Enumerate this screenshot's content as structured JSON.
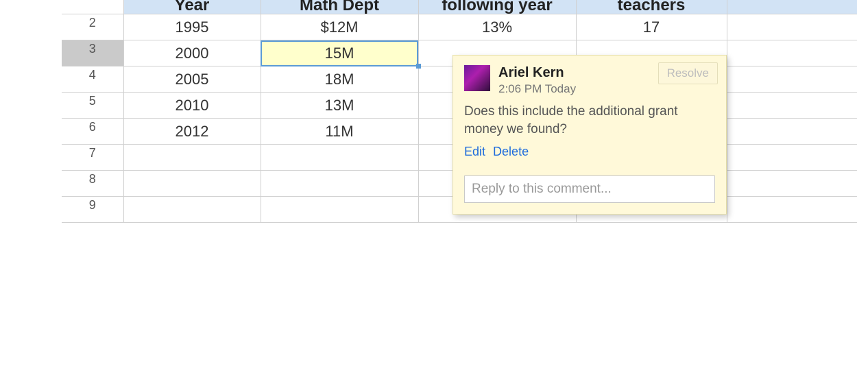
{
  "headers": {
    "year": "Year",
    "math": "Math Dept",
    "following": "following year",
    "teachers": "teachers"
  },
  "rows": [
    {
      "n": "2",
      "year": "1995",
      "math": "$12M",
      "following": "13%",
      "teachers": "17"
    },
    {
      "n": "3",
      "year": "2000",
      "math": "15M",
      "following": "",
      "teachers": ""
    },
    {
      "n": "4",
      "year": "2005",
      "math": "18M",
      "following": "",
      "teachers": ""
    },
    {
      "n": "5",
      "year": "2010",
      "math": "13M",
      "following": "",
      "teachers": ""
    },
    {
      "n": "6",
      "year": "2012",
      "math": "11M",
      "following": "",
      "teachers": ""
    },
    {
      "n": "7",
      "year": "",
      "math": "",
      "following": "",
      "teachers": ""
    },
    {
      "n": "8",
      "year": "",
      "math": "",
      "following": "",
      "teachers": ""
    },
    {
      "n": "9",
      "year": "",
      "math": "",
      "following": "",
      "teachers": ""
    }
  ],
  "selected_row": "3",
  "comment": {
    "author": "Ariel Kern",
    "time": "2:06 PM Today",
    "body": "Does this include the additional grant money we found?",
    "edit_label": "Edit",
    "delete_label": "Delete",
    "resolve_label": "Resolve",
    "reply_placeholder": "Reply to this comment..."
  }
}
